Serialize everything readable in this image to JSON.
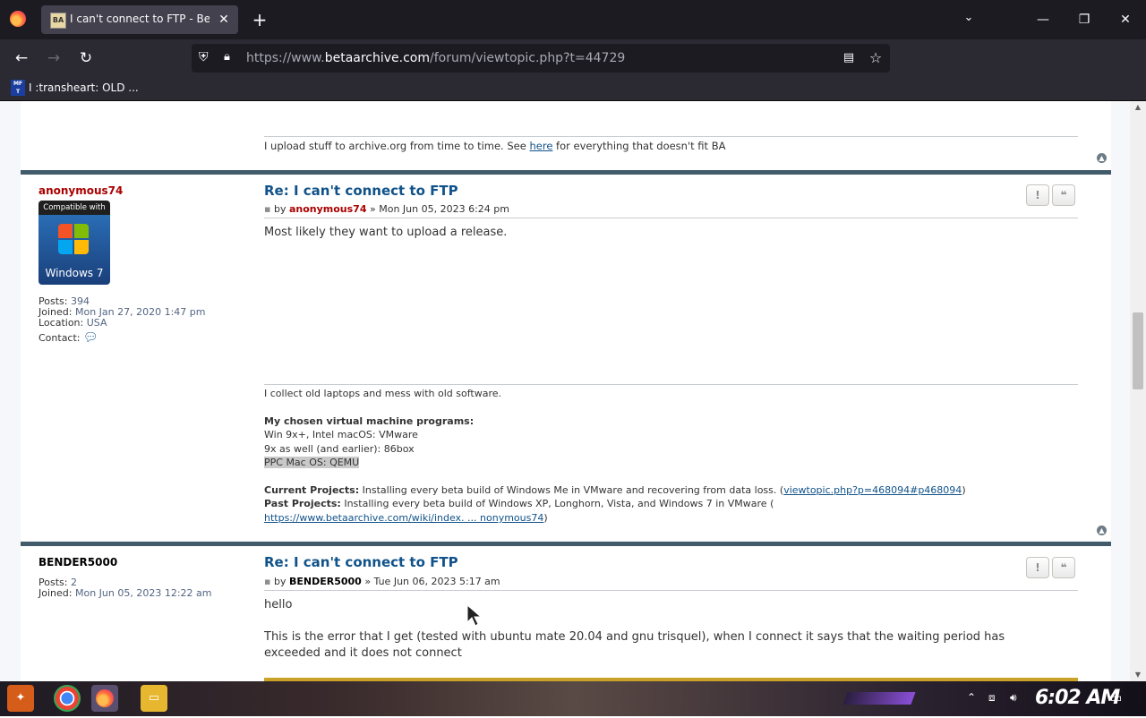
{
  "browser": {
    "tab_title": "I can't connect to FTP - Beta",
    "tab_favicon": "BA",
    "url_prefix": "https://www.",
    "url_domain": "betaarchive.com",
    "url_path": "/forum/viewtopic.php?t=44729",
    "bookmark_label": "I :transheart: OLD ...",
    "bookmark_icon": "MF T"
  },
  "prev_signature": {
    "text_before": "I upload stuff to archive.org from time to time. See ",
    "link": "here",
    "text_after": " for everything that doesn't fit BA"
  },
  "post1": {
    "author": "anonymous74",
    "badge_top": "Compatible with",
    "badge_text": "Windows 7",
    "stats": {
      "posts_label": "Posts:",
      "posts": "394",
      "joined_label": "Joined:",
      "joined": "Mon Jan 27, 2020 1:47 pm",
      "location_label": "Location:",
      "location": "USA",
      "contact_label": "Contact:"
    },
    "title": "Re: I can't connect to FTP",
    "meta_by": "by",
    "meta_author": "anonymous74",
    "meta_date": "» Mon Jun 05, 2023 6:24 pm",
    "body": "Most likely they want to upload a release.",
    "signature": {
      "line1": "I collect old laptops and mess with old software.",
      "vm_heading": "My chosen virtual machine programs:",
      "vm1": "Win 9x+, Intel macOS: VMware",
      "vm2": "9x as well (and earlier): 86box",
      "vm3": "PPC Mac OS: QEMU",
      "current_label": "Current Projects:",
      "current_text": " Installing every beta build of Windows Me in VMware and recovering from data loss. (",
      "current_link": "viewtopic.php?p=468094#p468094",
      "current_close": ")",
      "past_label": "Past Projects:",
      "past_text": " Installing every beta build of Windows XP, Longhorn, Vista, and Windows 7 in VMware (",
      "past_link": "https://www.betaarchive.com/wiki/index. ... nonymous74",
      "past_close": ")"
    }
  },
  "post2": {
    "author": "BENDER5000",
    "stats": {
      "posts_label": "Posts:",
      "posts": "2",
      "joined_label": "Joined:",
      "joined": "Mon Jun 05, 2023 12:22 am"
    },
    "title": "Re: I can't connect to FTP",
    "meta_by": "by",
    "meta_author": "BENDER5000",
    "meta_date": "» Tue Jun 06, 2023 5:17 am",
    "body_line1": "hello",
    "body_line2": "This is the error that I get (tested with ubuntu mate 20.04 and gnu trisquel), when I connect it says that the waiting period has exceeded and it does not connect"
  },
  "post_buttons": {
    "report": "!",
    "quote": "❝"
  },
  "taskbar": {
    "clock": "6:02 AM"
  },
  "colors": {
    "username": "#aa0000",
    "link": "#105289",
    "separator": "#425b6b"
  }
}
